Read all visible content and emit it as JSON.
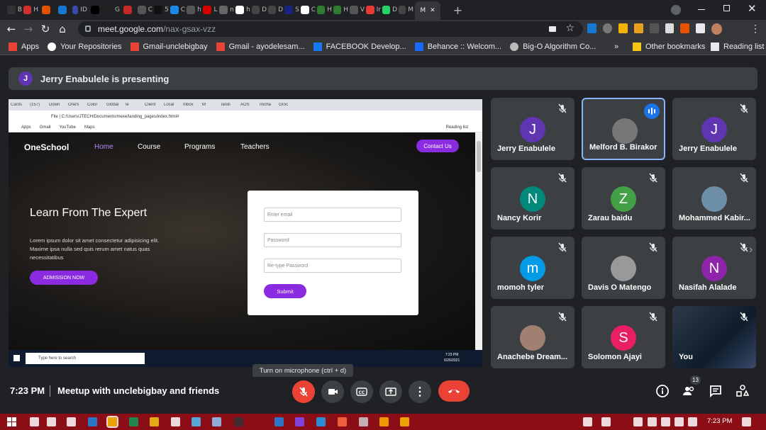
{
  "browser": {
    "tabs": [
      "B",
      "H",
      "",
      "",
      "ID",
      "",
      "G",
      "",
      "C",
      "5",
      "C",
      "h",
      "L",
      "n",
      "h",
      "D",
      "D",
      "S",
      "C",
      "H",
      "H",
      "V",
      "Ir",
      "D",
      "M"
    ],
    "active_tab_label": "M",
    "url_host": "meet.google.com",
    "url_path": "/nax-gsax-vzz",
    "bookmarks": [
      "Apps",
      "Your Repositories",
      "Gmail-unclebigbay",
      "Gmail - ayodelesam...",
      "FACEBOOK Develop...",
      "Behance :: Welcom...",
      "Big-O Algorithm Co..."
    ],
    "other_bookmarks": "Other bookmarks",
    "reading_list": "Reading list"
  },
  "presenting": {
    "avatar_letter": "J",
    "text": "Jerry Enabulele is presenting"
  },
  "shared_screen": {
    "inner_tabs": [
      "Cards",
      "(157)",
      "Down",
      "OneS",
      "Color",
      "Global",
      "le",
      "Client",
      "Local",
      "Inbox",
      "M",
      "landi",
      "AOS",
      "micha",
      "Groc"
    ],
    "inner_url": "File  |  C:/Users/JTECH/Documents/mexe/landing_pages/index.html#",
    "inner_bookmarks": [
      "Apps",
      "Gmail",
      "YouTube",
      "Maps"
    ],
    "inner_reading": "Reading list",
    "site": {
      "logo": "OneSchool",
      "nav": [
        "Home",
        "Course",
        "Programs",
        "Teachers"
      ],
      "contact": "Contact Us",
      "hero_title": "Learn From The Expert",
      "hero_text": "Lorem ipsum dolor sit amet consectetur adipisicing elit. Maxime ipsa nulla sed quis rerum amet natus quas necessitatibus",
      "admission": "ADMISSION NOW",
      "form": {
        "email": "Enter email",
        "password": "Password",
        "retype": "Re-type Password",
        "submit": "Submit"
      }
    },
    "taskbar_search": "Type here to search",
    "taskbar_time": "7:23 PM",
    "taskbar_date": "6/26/2021"
  },
  "participants": [
    {
      "name": "Jerry Enabulele",
      "letter": "J",
      "color": "#5f35b1",
      "muted": true
    },
    {
      "name": "Melford B. Birakor",
      "letter": "",
      "color": "#777777",
      "muted": false,
      "speaking": true
    },
    {
      "name": "Jerry Enabulele",
      "letter": "J",
      "color": "#5f35b1",
      "muted": true
    },
    {
      "name": "Nancy Korir",
      "letter": "N",
      "color": "#00897b",
      "muted": true
    },
    {
      "name": "Zarau baidu",
      "letter": "Z",
      "color": "#43a047",
      "muted": true
    },
    {
      "name": "Mohammed Kabir...",
      "letter": "",
      "color": "#6d8fa7",
      "muted": true
    },
    {
      "name": "momoh tyler",
      "letter": "m",
      "color": "#039be5",
      "muted": true
    },
    {
      "name": "Davis O Matengo",
      "letter": "",
      "color": "#999999",
      "muted": true
    },
    {
      "name": "Nasifah Alalade",
      "letter": "N",
      "color": "#8e24aa",
      "muted": true
    },
    {
      "name": "Anachebe Dream...",
      "letter": "",
      "color": "#a08070",
      "muted": true
    },
    {
      "name": "Solomon Ajayi",
      "letter": "S",
      "color": "#e91e63",
      "muted": true
    },
    {
      "name": "You",
      "letter": "",
      "color": "#1a2a3a",
      "muted": true
    }
  ],
  "tooltip": "Turn on microphone (ctrl + d)",
  "meeting": {
    "time": "7:23 PM",
    "title": "Meetup with unclebigbay and friends",
    "people_count": "13"
  },
  "taskbar": {
    "time": "7:23 PM"
  },
  "colors": {
    "accent": "#8a2be2",
    "hangup": "#ea4335",
    "highlight": "#8ab4f8"
  }
}
